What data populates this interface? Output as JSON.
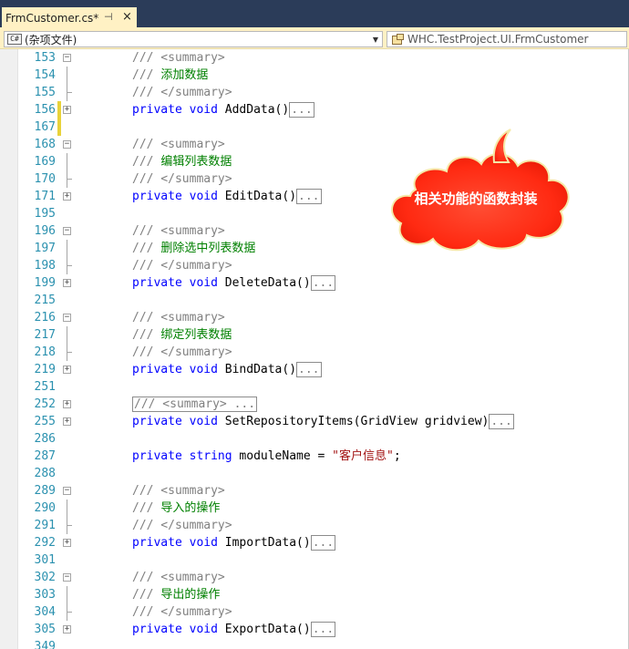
{
  "tab": {
    "label": "FrmCustomer.cs*",
    "pin": "⊣",
    "close": "×"
  },
  "navbar": {
    "left": {
      "icon": "C#",
      "text": "(杂项文件)"
    },
    "right": {
      "text": "WHC.TestProject.UI.FrmCustomer"
    }
  },
  "callout": {
    "text": "相关功能的函数封装"
  },
  "lines": [
    {
      "num": "153",
      "fold": "minus",
      "segments": [
        [
          "doc",
          "/// <summary>"
        ]
      ]
    },
    {
      "num": "154",
      "fold": "line",
      "segments": [
        [
          "doc",
          "/// "
        ],
        [
          "cmt",
          "添加数据"
        ]
      ]
    },
    {
      "num": "155",
      "fold": "line",
      "segments": [
        [
          "doc",
          "/// </summary>"
        ]
      ]
    },
    {
      "num": "156",
      "fold": "plus",
      "changed": true,
      "segments": [
        [
          "kw",
          "private"
        ],
        [
          "plain",
          " "
        ],
        [
          "kw",
          "void"
        ],
        [
          "plain",
          " AddData()"
        ],
        [
          "box",
          "..."
        ]
      ]
    },
    {
      "num": "167",
      "fold": "none",
      "changed": true,
      "segments": []
    },
    {
      "num": "168",
      "fold": "minus",
      "segments": [
        [
          "doc",
          "/// <summary>"
        ]
      ]
    },
    {
      "num": "169",
      "fold": "line",
      "segments": [
        [
          "doc",
          "/// "
        ],
        [
          "cmt",
          "编辑列表数据"
        ]
      ]
    },
    {
      "num": "170",
      "fold": "line",
      "segments": [
        [
          "doc",
          "/// </summary>"
        ]
      ]
    },
    {
      "num": "171",
      "fold": "plus",
      "segments": [
        [
          "kw",
          "private"
        ],
        [
          "plain",
          " "
        ],
        [
          "kw",
          "void"
        ],
        [
          "plain",
          " EditData()"
        ],
        [
          "box",
          "..."
        ]
      ]
    },
    {
      "num": "195",
      "fold": "none",
      "segments": []
    },
    {
      "num": "196",
      "fold": "minus",
      "segments": [
        [
          "doc",
          "/// <summary>"
        ]
      ]
    },
    {
      "num": "197",
      "fold": "line",
      "segments": [
        [
          "doc",
          "/// "
        ],
        [
          "cmt",
          "删除选中列表数据"
        ]
      ]
    },
    {
      "num": "198",
      "fold": "line",
      "segments": [
        [
          "doc",
          "/// </summary>"
        ]
      ]
    },
    {
      "num": "199",
      "fold": "plus",
      "segments": [
        [
          "kw",
          "private"
        ],
        [
          "plain",
          " "
        ],
        [
          "kw",
          "void"
        ],
        [
          "plain",
          " DeleteData()"
        ],
        [
          "box",
          "..."
        ]
      ]
    },
    {
      "num": "215",
      "fold": "none",
      "segments": []
    },
    {
      "num": "216",
      "fold": "minus",
      "segments": [
        [
          "doc",
          "/// <summary>"
        ]
      ]
    },
    {
      "num": "217",
      "fold": "line",
      "segments": [
        [
          "doc",
          "/// "
        ],
        [
          "cmt",
          "绑定列表数据"
        ]
      ]
    },
    {
      "num": "218",
      "fold": "line",
      "segments": [
        [
          "doc",
          "/// </summary>"
        ]
      ]
    },
    {
      "num": "219",
      "fold": "plus",
      "segments": [
        [
          "kw",
          "private"
        ],
        [
          "plain",
          " "
        ],
        [
          "kw",
          "void"
        ],
        [
          "plain",
          " BindData()"
        ],
        [
          "box",
          "..."
        ]
      ]
    },
    {
      "num": "251",
      "fold": "none",
      "segments": []
    },
    {
      "num": "252",
      "fold": "plus",
      "segments": [
        [
          "box",
          "/// <summary> ..."
        ]
      ]
    },
    {
      "num": "255",
      "fold": "plus",
      "segments": [
        [
          "kw",
          "private"
        ],
        [
          "plain",
          " "
        ],
        [
          "kw",
          "void"
        ],
        [
          "plain",
          " SetRepositoryItems(GridView gridview)"
        ],
        [
          "box",
          "..."
        ]
      ]
    },
    {
      "num": "286",
      "fold": "none",
      "segments": []
    },
    {
      "num": "287",
      "fold": "none",
      "segments": [
        [
          "kw",
          "private"
        ],
        [
          "plain",
          " "
        ],
        [
          "kw",
          "string"
        ],
        [
          "plain",
          " moduleName = "
        ],
        [
          "str",
          "\"客户信息\""
        ],
        [
          "plain",
          ";"
        ]
      ]
    },
    {
      "num": "288",
      "fold": "none",
      "segments": []
    },
    {
      "num": "289",
      "fold": "minus",
      "segments": [
        [
          "doc",
          "/// <summary>"
        ]
      ]
    },
    {
      "num": "290",
      "fold": "line",
      "segments": [
        [
          "doc",
          "/// "
        ],
        [
          "cmt",
          "导入的操作"
        ]
      ]
    },
    {
      "num": "291",
      "fold": "line",
      "segments": [
        [
          "doc",
          "/// </summary>"
        ]
      ]
    },
    {
      "num": "292",
      "fold": "plus",
      "segments": [
        [
          "kw",
          "private"
        ],
        [
          "plain",
          " "
        ],
        [
          "kw",
          "void"
        ],
        [
          "plain",
          " ImportData()"
        ],
        [
          "box",
          "..."
        ]
      ]
    },
    {
      "num": "301",
      "fold": "none",
      "segments": []
    },
    {
      "num": "302",
      "fold": "minus",
      "segments": [
        [
          "doc",
          "/// <summary>"
        ]
      ]
    },
    {
      "num": "303",
      "fold": "line",
      "segments": [
        [
          "doc",
          "/// "
        ],
        [
          "cmt",
          "导出的操作"
        ]
      ]
    },
    {
      "num": "304",
      "fold": "line",
      "segments": [
        [
          "doc",
          "/// </summary>"
        ]
      ]
    },
    {
      "num": "305",
      "fold": "plus",
      "segments": [
        [
          "kw",
          "private"
        ],
        [
          "plain",
          " "
        ],
        [
          "kw",
          "void"
        ],
        [
          "plain",
          " ExportData()"
        ],
        [
          "box",
          "..."
        ]
      ]
    },
    {
      "num": "349",
      "fold": "none",
      "segments": []
    }
  ]
}
